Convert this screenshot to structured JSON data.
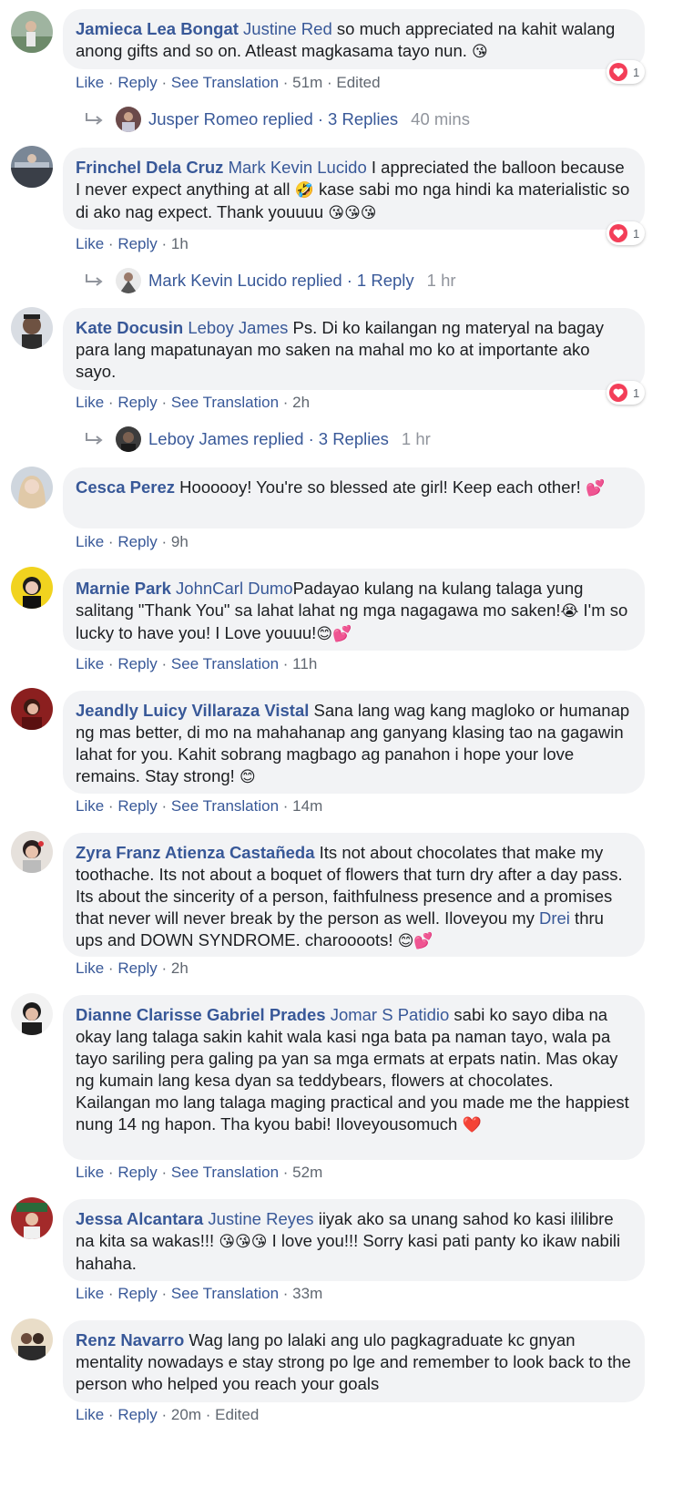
{
  "comments": [
    {
      "author": "Jamieca Lea Bongat",
      "mention": "Justine Red",
      "text": " so much appreciated na kahit walang anong gifts and so on. Atleast magkasama tayo nun. ",
      "emoji": "😘",
      "actions": {
        "like": "Like",
        "reply": "Reply",
        "translate": "See Translation",
        "time": "51m",
        "edited": "Edited"
      },
      "reactions": "1",
      "replies": {
        "name": "Jusper Romeo",
        "label": "replied",
        "count": "3 Replies",
        "time": "40 mins"
      }
    },
    {
      "author": "Frinchel Dela Cruz",
      "mention": "Mark Kevin Lucido",
      "text_a": " I appreciated the balloon because I never expect anything at all ",
      "emoji_a": "🤣",
      "text_b": " kase sabi mo nga hindi ka materialistic so di ako nag expect. Thank youuuu ",
      "emoji_b": "😘😘😘",
      "actions": {
        "like": "Like",
        "reply": "Reply",
        "time": "1h"
      },
      "reactions": "1",
      "replies": {
        "name": "Mark Kevin Lucido",
        "label": "replied",
        "count": "1 Reply",
        "time": "1 hr"
      }
    },
    {
      "author": "Kate Docusin",
      "mention": "Leboy James",
      "text": " Ps. Di ko kailangan ng materyal na bagay para lang mapatunayan mo saken na mahal mo ko at importante ako sayo.",
      "actions": {
        "like": "Like",
        "reply": "Reply",
        "translate": "See Translation",
        "time": "2h"
      },
      "reactions": "1",
      "replies": {
        "name": "Leboy James",
        "label": "replied",
        "count": "3 Replies",
        "time": "1 hr"
      }
    },
    {
      "author": "Cesca Perez",
      "text": " Hoooooy! You're so blessed ate girl! Keep each other! ",
      "emoji": "💕",
      "actions": {
        "like": "Like",
        "reply": "Reply",
        "time": "9h"
      }
    },
    {
      "author": "Marnie Park",
      "mention": "JohnCarl Dumo",
      "text_a": "Padayao kulang na kulang talaga yung salitang \"Thank You\" sa lahat lahat ng mga nagagawa mo saken!",
      "emoji_a": "😭",
      "text_b": " I'm so lucky to have you! I Love youuu!",
      "emoji_b": "😊💕",
      "actions": {
        "like": "Like",
        "reply": "Reply",
        "translate": "See Translation",
        "time": "11h"
      }
    },
    {
      "author": "Jeandly Luicy Villaraza Vistal",
      "text": " Sana lang wag kang magloko or humanap ng mas better, di mo na mahahanap ang ganyang klasing tao na gagawin lahat for you. Kahit sobrang magbago ag panahon i hope your love remains. Stay strong! ",
      "emoji": "😊",
      "actions": {
        "like": "Like",
        "reply": "Reply",
        "translate": "See Translation",
        "time": "14m"
      }
    },
    {
      "author": "Zyra Franz Atienza Castañeda",
      "text_a": " Its not about chocolates that make my toothache. Its not about a boquet of flowers that turn dry after a day pass. Its about the sincerity of a person, faithfulness presence and a promises that never will never break by the person as well. Iloveyou my ",
      "mention": "Drei",
      "text_b": " thru ups and DOWN SYNDROME. charoooots! ",
      "emoji": "😊💕",
      "actions": {
        "like": "Like",
        "reply": "Reply",
        "time": "2h"
      }
    },
    {
      "author": "Dianne Clarisse Gabriel Prades",
      "mention": "Jomar S Patidio",
      "text": " sabi ko sayo diba na okay lang talaga sakin kahit wala kasi nga bata pa naman tayo, wala pa tayo sariling pera galing pa yan sa mga ermats at erpats natin. Mas okay ng kumain lang kesa dyan sa teddybears, flowers at chocolates. Kailangan mo lang talaga maging practical and you made me the happiest nung 14 ng hapon. Tha kyou babi! Iloveyousomuch ",
      "emoji": "❤️",
      "actions": {
        "like": "Like",
        "reply": "Reply",
        "translate": "See Translation",
        "time": "52m"
      }
    },
    {
      "author": "Jessa Alcantara",
      "mention": "Justine Reyes",
      "text_a": " iiyak ako sa unang sahod ko kasi ililibre na kita sa wakas!!! ",
      "emoji": "😘😘😘",
      "text_b": " I love you!!! Sorry kasi pati panty ko ikaw nabili hahaha.",
      "actions": {
        "like": "Like",
        "reply": "Reply",
        "translate": "See Translation",
        "time": "33m"
      }
    },
    {
      "author": "Renz Navarro",
      "text": " Wag lang po lalaki ang ulo pagkagraduate kc gnyan mentality nowadays e stay strong po lge and remember to look back to the person who helped you reach your goals",
      "actions": {
        "like": "Like",
        "reply": "Reply",
        "time": "20m",
        "edited": "Edited"
      }
    }
  ],
  "colors": {
    "link": "#385898",
    "bubble": "#f2f3f5",
    "meta": "#606770",
    "heart": "#f33e58"
  }
}
